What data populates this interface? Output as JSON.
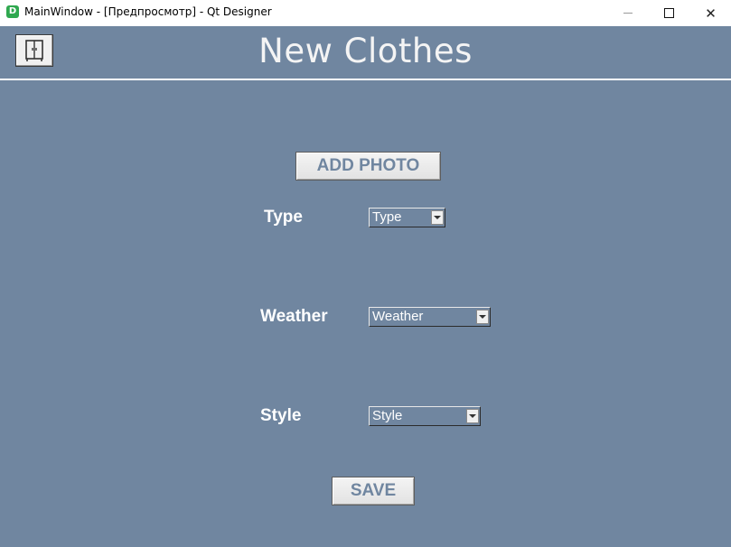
{
  "window": {
    "app_icon_letter": "D",
    "title": "MainWindow - [Предпросмотр] - Qt Designer",
    "close_glyph": "✕"
  },
  "header": {
    "title": "New Clothes",
    "wardrobe_icon": "wardrobe-icon"
  },
  "form": {
    "add_photo_label": "ADD PHOTO",
    "type": {
      "label": "Type",
      "selected": "Type"
    },
    "weather": {
      "label": "Weather",
      "selected": "Weather"
    },
    "style": {
      "label": "Style",
      "selected": "Style"
    },
    "save_label": "SAVE"
  },
  "colors": {
    "background": "#7086a0",
    "button_text": "#7086a0",
    "label_text": "#ffffff"
  }
}
